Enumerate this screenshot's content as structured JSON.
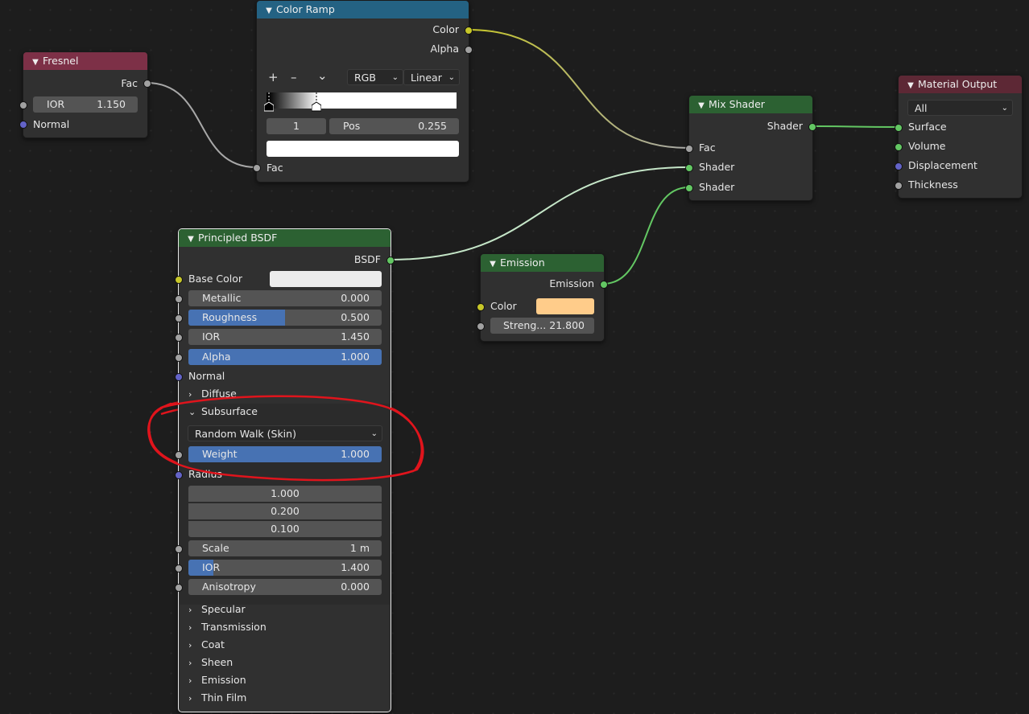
{
  "colors": {
    "canvas": "#1d1d1d",
    "node_body": "#303030",
    "header_converter": "#246283",
    "header_input": "#7d3047",
    "header_shader": "#2c6132",
    "header_output": "#5d2835",
    "field_bg": "#545454",
    "slider_fill": "#4772b3",
    "socket_float": "#a1a1a1",
    "socket_color": "#c7c729",
    "socket_shader": "#63c763",
    "socket_vector": "#6363c7",
    "annotation": "#e0141c",
    "emission_color": "#ffcc8a",
    "base_color": "#ececec"
  },
  "color_ramp": {
    "title": "Color Ramp",
    "out_color": "Color",
    "out_alpha": "Alpha",
    "add_icon": "+",
    "remove_icon": "–",
    "menu_icon": "⌄",
    "mode": "RGB",
    "interpolation": "Linear",
    "stop_index": "1",
    "pos_label": "Pos",
    "pos_value": "0.255",
    "in_fac": "Fac"
  },
  "fresnel": {
    "title": "Fresnel",
    "out_fac": "Fac",
    "ior_label": "IOR",
    "ior_value": "1.150",
    "in_normal": "Normal"
  },
  "mix_shader": {
    "title": "Mix Shader",
    "out_shader": "Shader",
    "in_fac": "Fac",
    "in_shader1": "Shader",
    "in_shader2": "Shader"
  },
  "material_output": {
    "title": "Material Output",
    "target": "All",
    "in_surface": "Surface",
    "in_volume": "Volume",
    "in_displacement": "Displacement",
    "in_thickness": "Thickness"
  },
  "emission": {
    "title": "Emission",
    "out_emission": "Emission",
    "color_label": "Color",
    "strength_label": "Streng...",
    "strength_value": "21.800"
  },
  "bsdf": {
    "title": "Principled BSDF",
    "out_bsdf": "BSDF",
    "base_color_label": "Base Color",
    "metallic": {
      "label": "Metallic",
      "value": "0.000",
      "fraction": 0
    },
    "roughness": {
      "label": "Roughness",
      "value": "0.500",
      "fraction": 0.5
    },
    "ior": {
      "label": "IOR",
      "value": "1.450",
      "fraction": 0
    },
    "alpha": {
      "label": "Alpha",
      "value": "1.000",
      "fraction": 1
    },
    "normal_label": "Normal",
    "diffuse_panel": "Diffuse",
    "subsurface_panel": "Subsurface",
    "subsurface_method": "Random Walk (Skin)",
    "weight": {
      "label": "Weight",
      "value": "1.000",
      "fraction": 1
    },
    "radius_label": "Radius",
    "radius_values": [
      "1.000",
      "0.200",
      "0.100"
    ],
    "scale": {
      "label": "Scale",
      "value": "1 m",
      "fraction": 0
    },
    "sss_ior": {
      "label": "IOR",
      "value": "1.400",
      "fraction": 0.13
    },
    "anisotropy": {
      "label": "Anisotropy",
      "value": "0.000",
      "fraction": 0
    },
    "panels": [
      "Specular",
      "Transmission",
      "Coat",
      "Sheen",
      "Emission",
      "Thin Film"
    ]
  }
}
